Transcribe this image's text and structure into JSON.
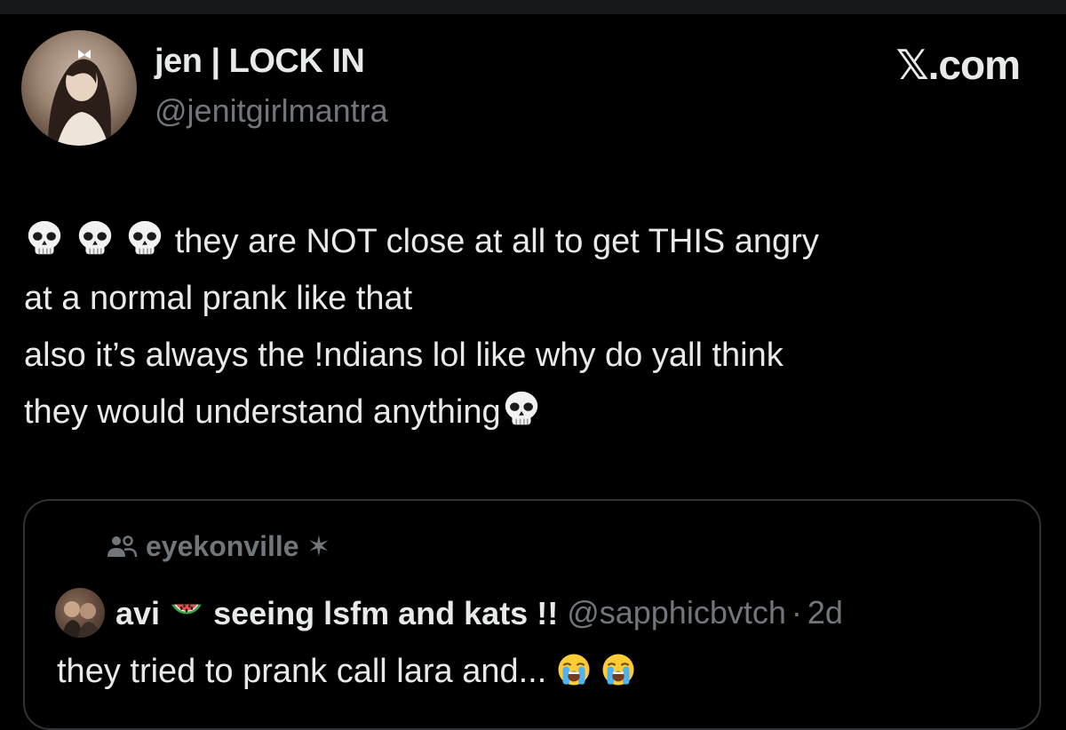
{
  "author": {
    "display_name": "jen | LOCK IN",
    "handle": "@jenitgirlmantra",
    "avatar_icon": "profile-photo"
  },
  "brand": {
    "label": "𝕏.com"
  },
  "tweet": {
    "line1_text": "they are NOT close at all to get THIS angry",
    "line2_text": "at a normal prank like that",
    "line3_text": "also it’s always the !ndians lol like why do yall think",
    "line4_text": "they would understand anything",
    "emoji_icon": "skull-emoji"
  },
  "quote": {
    "community_icon": "community-people-icon",
    "community_name": "eyekonville ✶",
    "name_prefix": "avi",
    "name_suffix": "seeing lsfm and kats !!",
    "name_emoji": "watermelon-emoji",
    "handle": "@sapphicbvtch",
    "separator": "·",
    "time": "2d",
    "text": "they tried to prank call lara and...",
    "text_emoji": "loudly-crying-face-emoji"
  },
  "colors": {
    "background": "#000000",
    "text_primary": "#e7e9ea",
    "text_secondary": "#71767b",
    "card_border": "#2f3336"
  }
}
